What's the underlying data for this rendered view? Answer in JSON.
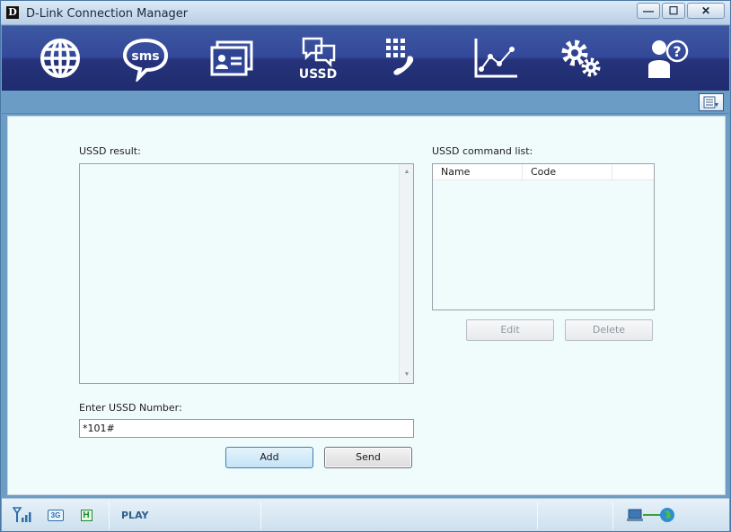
{
  "window": {
    "title": "D-Link Connection Manager",
    "logo_letter": "D",
    "minimize_glyph": "—",
    "maximize_glyph": "☐",
    "close_glyph": "✕"
  },
  "toolbar": {
    "items": [
      {
        "icon": "globe-icon",
        "name": "internet"
      },
      {
        "icon": "sms-icon",
        "name": "sms",
        "text": "sms"
      },
      {
        "icon": "contacts-icon",
        "name": "phonebook"
      },
      {
        "icon": "ussd-icon",
        "name": "ussd",
        "text": "USSD"
      },
      {
        "icon": "phone-dialpad-icon",
        "name": "call"
      },
      {
        "icon": "statistics-chart-icon",
        "name": "statistics"
      },
      {
        "icon": "settings-gears-icon",
        "name": "settings"
      },
      {
        "icon": "help-user-icon",
        "name": "help"
      }
    ]
  },
  "ussd": {
    "result_label": "USSD result:",
    "result_text": "",
    "command_list_label": "USSD command list:",
    "columns": [
      "Name",
      "Code"
    ],
    "rows": [],
    "edit_button": "Edit",
    "delete_button": "Delete",
    "enter_label": "Enter USSD Number:",
    "number_value": "*101#",
    "add_button": "Add",
    "send_button": "Send"
  },
  "statusbar": {
    "signal_icon": "signal-strength-icon",
    "network_badge": "3G",
    "hspa_badge": "H",
    "operator": "PLAY",
    "connection_icon": "connected-globe-icon"
  },
  "colors": {
    "toolbar_bg": "#2b3a86",
    "content_bg": "#f0fbfc",
    "subbar_bg": "#6a9cc5"
  }
}
